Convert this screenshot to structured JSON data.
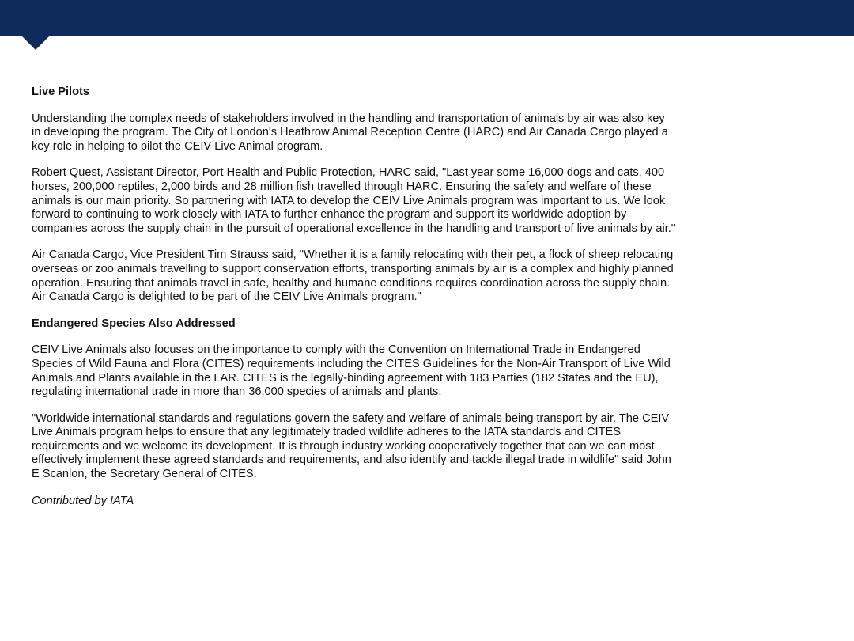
{
  "article": {
    "section1_heading": "Live Pilots",
    "section1_paragraphs": [
      "Understanding the complex needs of stakeholders involved in the handling and transportation of animals by air was also key in developing the program. The City of London's Heathrow Animal Reception Centre (HARC) and Air Canada Cargo played a key role in helping to pilot the CEIV Live Animal program.",
      "Robert Quest, Assistant Director, Port Health and Public Protection, HARC said, \"Last year some 16,000 dogs and cats, 400 horses, 200,000 reptiles, 2,000 birds and 28 million fish travelled through HARC. Ensuring the safety and welfare of these animals is our main priority. So partnering with IATA to develop the CEIV Live Animals program was important to us. We look forward to continuing to work closely with IATA to further enhance the program and support its worldwide adoption by companies across the supply chain in the pursuit of operational excellence in the handling and transport of live animals by air.\"",
      "Air Canada Cargo, Vice President Tim Strauss said, \"Whether it is a family relocating with their pet, a flock of sheep relocating overseas or zoo animals travelling to support conservation efforts, transporting animals by air is a complex and highly planned operation. Ensuring that animals travel in safe, healthy and humane conditions requires coordination across the supply chain. Air Canada Cargo is delighted to be part of the CEIV Live Animals program.\""
    ],
    "section2_heading": "Endangered Species Also Addressed",
    "section2_paragraphs": [
      "CEIV Live Animals also focuses on the importance to comply with the Convention on International Trade in Endangered Species of Wild Fauna and Flora (CITES) requirements including the CITES Guidelines for the Non-Air Transport of Live Wild Animals and Plants available in the LAR. CITES is the legally-binding agreement with 183 Parties (182 States and the EU), regulating international trade in more than 36,000 species of animals and plants.",
      "\"Worldwide international standards and regulations govern the safety and welfare of animals being transport by air. The CEIV Live Animals program helps to ensure that any legitimately traded wildlife adheres to the IATA standards and CITES requirements and we welcome its development. It is through industry working cooperatively together that can we can most effectively implement these agreed standards and requirements, and also identify and tackle illegal trade in wildlife\" said John E Scanlon, the Secretary General of CITES."
    ],
    "credit": "Contributed by IATA"
  },
  "colors": {
    "header_bar": "#0f2a5c",
    "footnote_rule": "#1a3f95"
  }
}
